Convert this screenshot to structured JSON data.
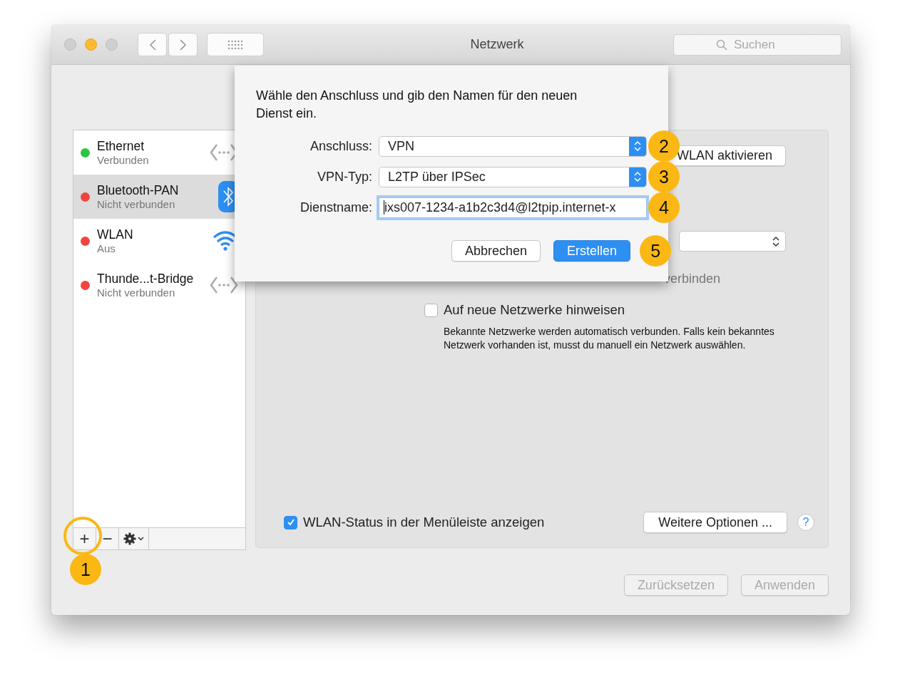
{
  "window": {
    "title": "Netzwerk",
    "search": {
      "placeholder": "Suchen"
    }
  },
  "sidebar": {
    "items": [
      {
        "name": "Ethernet",
        "status": "Verbunden",
        "color": "#2fc43f",
        "kind": "ethernet",
        "selected": false
      },
      {
        "name": "Bluetooth-PAN",
        "status": "Nicht verbunden",
        "color": "#f0453f",
        "kind": "bluetooth",
        "selected": true
      },
      {
        "name": "WLAN",
        "status": "Aus",
        "color": "#f0453f",
        "kind": "wifi",
        "selected": false
      },
      {
        "name": "Thunde...t-Bridge",
        "status": "Nicht verbunden",
        "color": "#f0453f",
        "kind": "ethernet",
        "selected": false
      }
    ],
    "add_button": {
      "label": "+",
      "callout": "1"
    },
    "remove_button": {
      "label": "−"
    }
  },
  "panel": {
    "wlan_button": "WLAN aktivieren",
    "hidden_option_tail": "verbinden",
    "notify": {
      "label": "Auf neue Netzwerke hinweisen",
      "checked": false
    },
    "notify_help": "Bekannte Netzwerke werden automatisch verbunden. Falls kein bekanntes Netzwerk vorhanden ist, musst du manuell ein Netzwerk auswählen.",
    "menubar_status": {
      "label": "WLAN-Status in der Menüleiste anzeigen",
      "checked": true
    },
    "more_button": "Weitere Optionen ...",
    "help_button": "?"
  },
  "footer_buttons": [
    {
      "label": "Zurücksetzen",
      "disabled": true
    },
    {
      "label": "Anwenden",
      "disabled": true
    }
  ],
  "dialog": {
    "message": "Wähle den Anschluss und gib den Namen für den neuen Dienst ein.",
    "fields": [
      {
        "label": "Anschluss:",
        "kind": "popup",
        "value": "VPN",
        "callout": "2"
      },
      {
        "label": "VPN-Typ:",
        "kind": "popup",
        "value": "L2TP über IPSec",
        "callout": "3"
      },
      {
        "label": "Dienstname:",
        "kind": "text",
        "value": "ixs007-1234-a1b2c3d4@l2tpip.internet-x",
        "callout": "4"
      }
    ],
    "cancel_button": "Abbrechen",
    "create_button": {
      "label": "Erstellen",
      "callout": "5"
    }
  }
}
